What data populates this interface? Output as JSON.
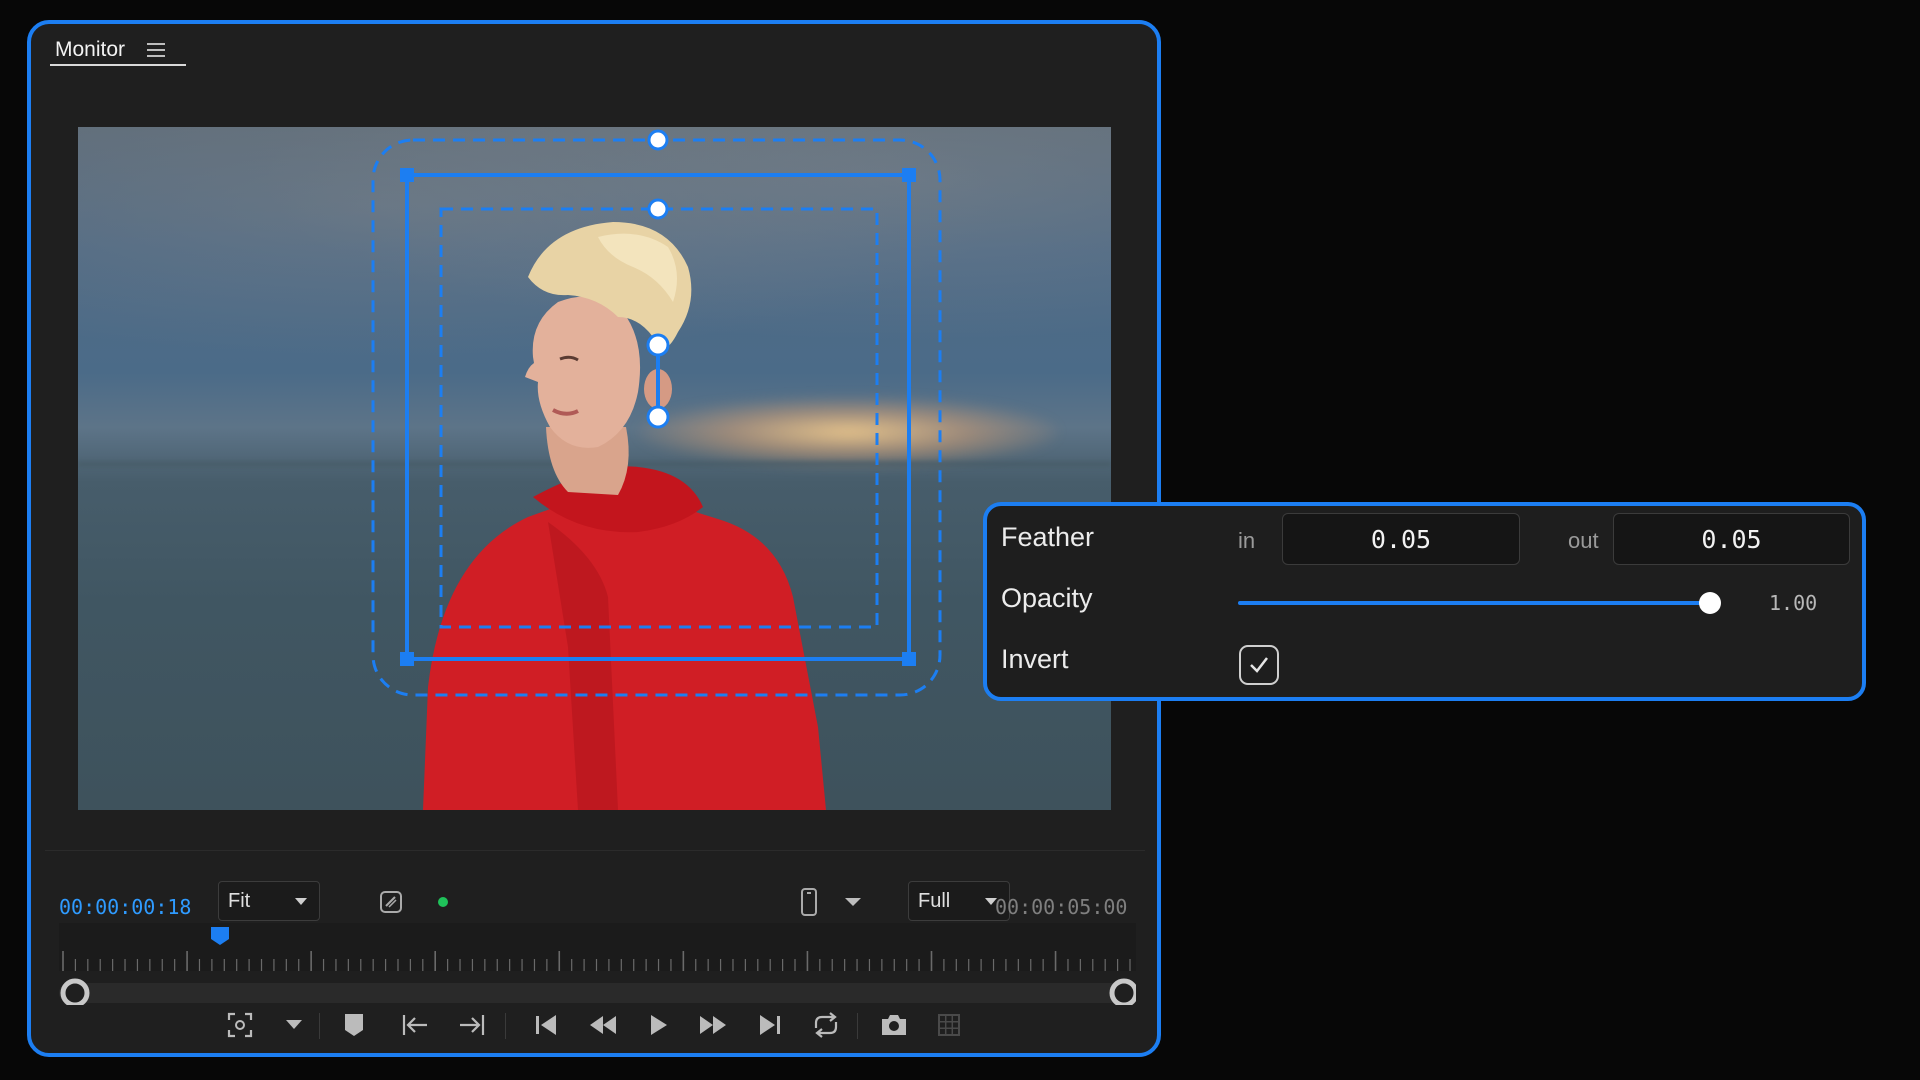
{
  "monitor": {
    "tab_label": "Monitor",
    "menu_icon": "hamburger-menu-icon"
  },
  "controls": {
    "current_timecode": "00:00:00:18",
    "zoom_value": "Fit",
    "resolution_value": "Full",
    "duration_timecode": "00:00:05:00",
    "icons": [
      "safe-margins-icon",
      "record-status-dot",
      "phone-aspect-icon",
      "chevron-down-icon",
      "playhead-icon"
    ],
    "transport_icons": [
      "focus-frame-icon",
      "chevron-down-icon",
      "marker-icon",
      "go-to-in-icon",
      "go-to-out-icon",
      "step-back-icon",
      "rewind-icon",
      "play-icon",
      "fast-forward-icon",
      "step-forward-icon",
      "loop-icon",
      "camera-icon",
      "grid-icon"
    ]
  },
  "feather_panel": {
    "feather_label": "Feather",
    "in_label": "in",
    "in_value": "0.05",
    "out_label": "out",
    "out_value": "0.05",
    "opacity_label": "Opacity",
    "opacity_value": "1.00",
    "opacity_level": 1.0,
    "invert_label": "Invert",
    "invert_checked": true
  },
  "colors": {
    "accent": "#1c7ef2",
    "timecode_current": "#2f9bff",
    "status_dot": "#1fc25a",
    "panel_bg": "#1f1f1f",
    "background": "#070707"
  }
}
